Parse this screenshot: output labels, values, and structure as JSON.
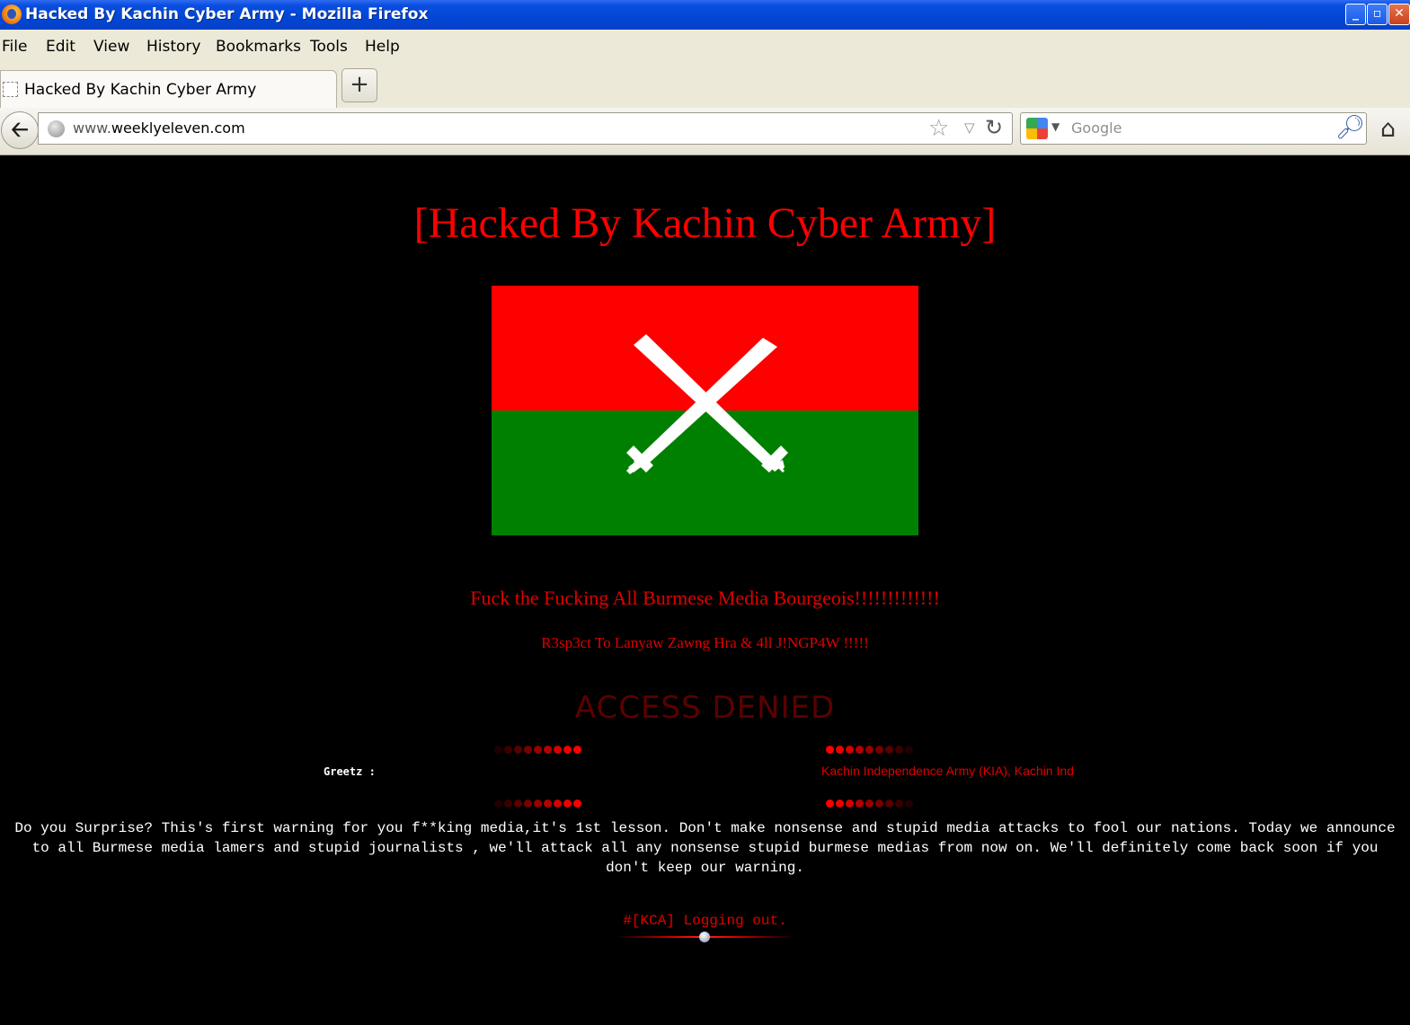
{
  "window": {
    "title": "Hacked By Kachin Cyber Army - Mozilla Firefox",
    "buttons": {
      "minimize": "_",
      "maximize": "▫",
      "close": "✕"
    }
  },
  "menu": [
    "File",
    "Edit",
    "View",
    "History",
    "Bookmarks",
    "Tools",
    "Help"
  ],
  "tabs": [
    {
      "label": "Hacked By Kachin Cyber Army",
      "active": true
    }
  ],
  "new_tab_label": "+",
  "navigation": {
    "url_prefix": "www.",
    "url_domain": "weeklyeleven.com",
    "search_placeholder": "Google",
    "search_engine_icon": "google-icon"
  },
  "page": {
    "heading": "[Hacked By Kachin Cyber Army]",
    "flag": {
      "top_color": "#ff0000",
      "bottom_color": "#008000",
      "emblem": "crossed-swords",
      "emblem_color": "#ffffff"
    },
    "message1": "Fuck the Fucking All Burmese Media Bourgeois!!!!!!!!!!!!!",
    "message2": "R3sp3ct To Lanyaw Zawng Hra & 4ll J!NGP4W !!!!!",
    "access_denied": "ACCESS DENIED",
    "greetz_label": "Greetz :",
    "greetz_text": "Kachin Independence Army (KIA), Kachin Ind",
    "warning": "Do you Surprise? This's first warning for you f**king media,it's 1st lesson. Don't make nonsense and stupid media attacks to fool our nations. Today we announce to all Burmese media lamers and stupid journalists , we'll attack all any nonsense stupid burmese medias from now on. We'll definitely come back soon if you don't keep our warning.",
    "logout": "#[KCA] Logging out."
  },
  "colors": {
    "accent_red": "#ff0000",
    "page_bg": "#000000",
    "titlebar_blue": "#0246d6"
  }
}
